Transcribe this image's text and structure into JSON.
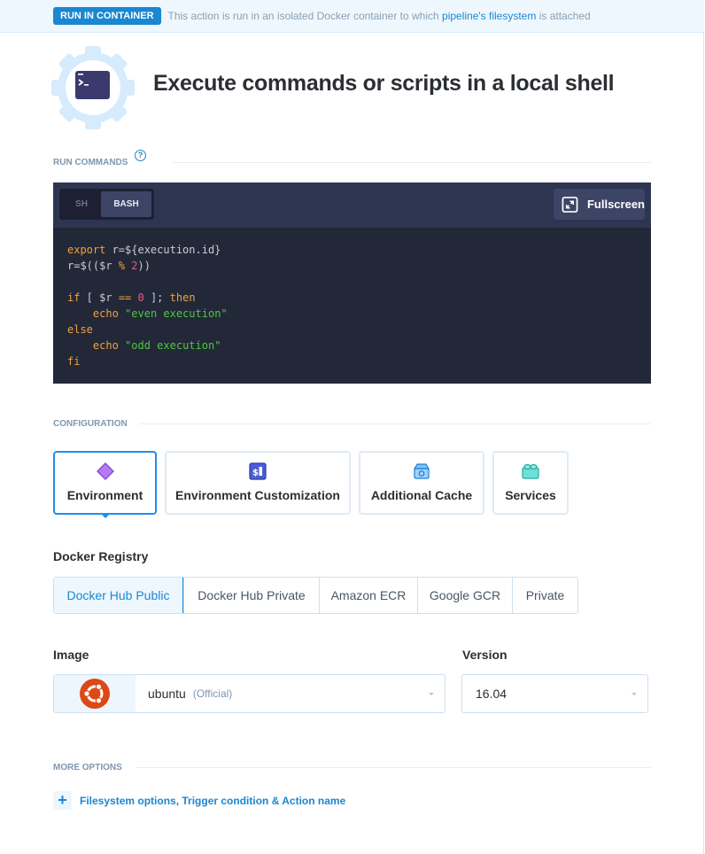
{
  "banner": {
    "badge": "RUN IN CONTAINER",
    "text_before": "This action is run in an isolated Docker container to which ",
    "link": "pipeline's filesystem",
    "text_after": " is attached"
  },
  "header": {
    "icon": "terminal-gear-icon",
    "title": "Execute commands or scripts in a local shell"
  },
  "run_commands": {
    "section_label": "RUN COMMANDS",
    "help_icon": "?",
    "languages": [
      "SH",
      "BASH"
    ],
    "selected_language": "BASH",
    "fullscreen_label": "Fullscreen",
    "code_lines": [
      [
        {
          "t": "export",
          "c": "kw"
        },
        {
          "t": " r=${execution.id}",
          "c": ""
        }
      ],
      [
        {
          "t": "r=$(($r ",
          "c": ""
        },
        {
          "t": "%",
          "c": "op"
        },
        {
          "t": " ",
          "c": ""
        },
        {
          "t": "2",
          "c": "num"
        },
        {
          "t": "))",
          "c": ""
        }
      ],
      [],
      [
        {
          "t": "if",
          "c": "kw"
        },
        {
          "t": " [ $r ",
          "c": ""
        },
        {
          "t": "==",
          "c": "op"
        },
        {
          "t": " ",
          "c": ""
        },
        {
          "t": "0",
          "c": "num"
        },
        {
          "t": " ]; ",
          "c": ""
        },
        {
          "t": "then",
          "c": "kw"
        }
      ],
      [
        {
          "t": "    ",
          "c": ""
        },
        {
          "t": "echo",
          "c": "kw"
        },
        {
          "t": " ",
          "c": ""
        },
        {
          "t": "\"even execution\"",
          "c": "str"
        }
      ],
      [
        {
          "t": "else",
          "c": "kw"
        }
      ],
      [
        {
          "t": "    ",
          "c": ""
        },
        {
          "t": "echo",
          "c": "kw"
        },
        {
          "t": " ",
          "c": ""
        },
        {
          "t": "\"odd execution\"",
          "c": "str"
        }
      ],
      [
        {
          "t": "fi",
          "c": "kw"
        }
      ]
    ]
  },
  "configuration": {
    "section_label": "CONFIGURATION",
    "cards": [
      {
        "label": "Environment",
        "icon": "diamond-icon",
        "active": true
      },
      {
        "label": "Environment Customization",
        "icon": "dollar-terminal-icon",
        "active": false
      },
      {
        "label": "Additional Cache",
        "icon": "cache-box-icon",
        "active": false
      },
      {
        "label": "Services",
        "icon": "services-block-icon",
        "active": false
      }
    ]
  },
  "docker_registry": {
    "label": "Docker Registry",
    "options": [
      "Docker Hub Public",
      "Docker Hub Private",
      "Amazon ECR",
      "Google GCR",
      "Private"
    ],
    "selected": "Docker Hub Public"
  },
  "image": {
    "label": "Image",
    "icon": "ubuntu-logo-icon",
    "value": "ubuntu",
    "tag": "(Official)"
  },
  "version": {
    "label": "Version",
    "value": "16.04"
  },
  "more_options": {
    "section_label": "MORE OPTIONS",
    "link": "Filesystem options, Trigger condition & Action name"
  },
  "colors": {
    "accent": "#1a87d0",
    "editor_bg": "#232839",
    "editor_toolbar": "#2e3551",
    "ubuntu_orange": "#dd4814"
  }
}
